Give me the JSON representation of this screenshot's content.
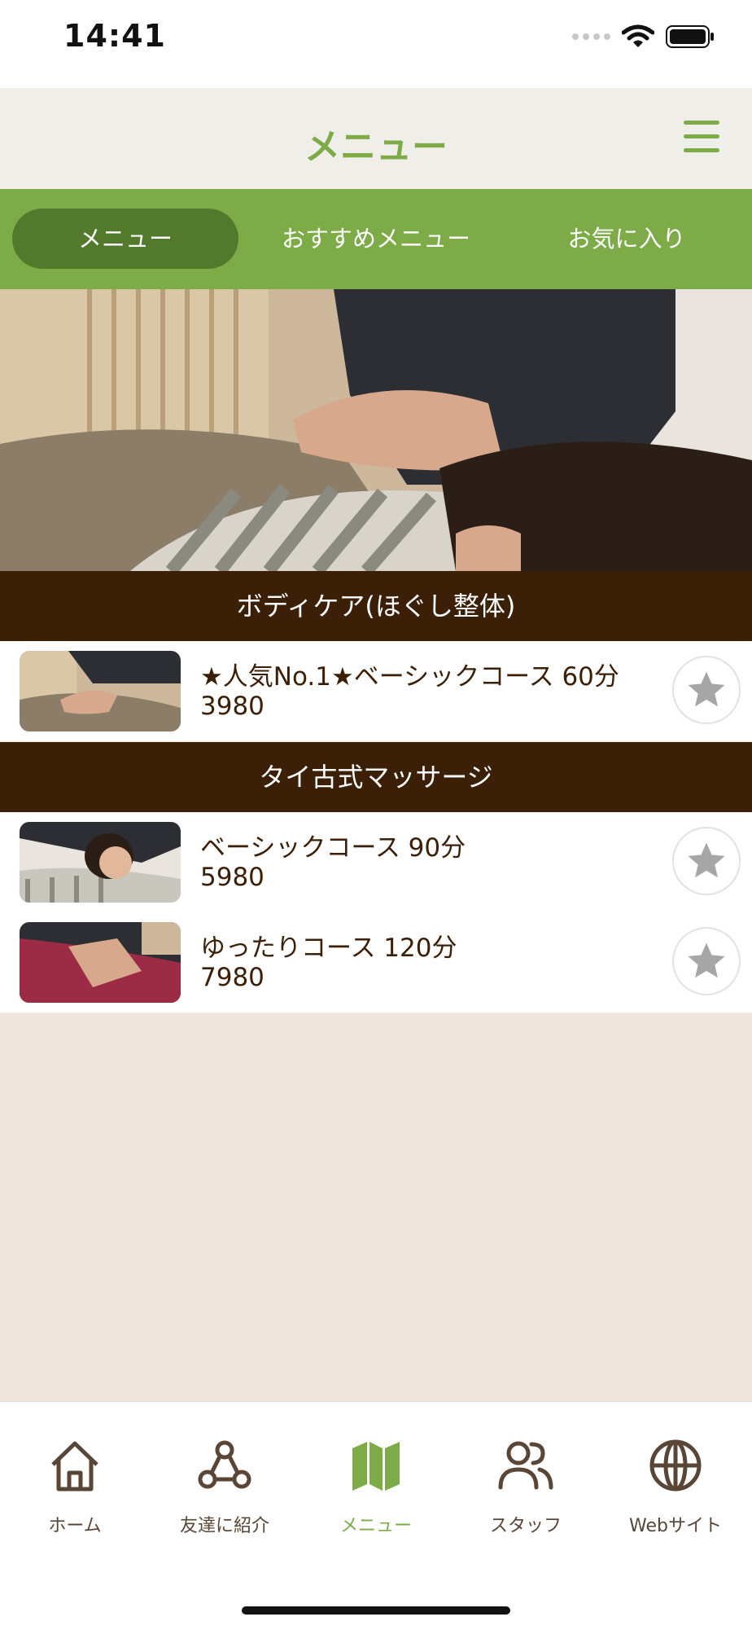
{
  "status_bar": {
    "time": "14:41"
  },
  "header": {
    "title": "メニュー",
    "menu_icon": "hamburger-menu-icon"
  },
  "tabs": [
    {
      "label": "メニュー",
      "active": true
    },
    {
      "label": "おすすめメニュー",
      "active": false
    },
    {
      "label": "お気に入り",
      "active": false
    }
  ],
  "sections": [
    {
      "title": "ボディケア(ほぐし整体)",
      "items": [
        {
          "title": "★人気No.1★ベーシックコース 60分",
          "price": "3980",
          "favorite_icon": "star-icon"
        }
      ]
    },
    {
      "title": "タイ古式マッサージ",
      "items": [
        {
          "title": "ベーシックコース 90分",
          "price": "5980",
          "favorite_icon": "star-icon"
        },
        {
          "title": "ゆったりコース 120分",
          "price": "7980",
          "favorite_icon": "star-icon"
        }
      ]
    }
  ],
  "tab_bar": {
    "items": [
      {
        "label": "ホーム",
        "icon": "home-icon",
        "active": false
      },
      {
        "label": "友達に紹介",
        "icon": "share-icon",
        "active": false
      },
      {
        "label": "メニュー",
        "icon": "map-icon",
        "active": true
      },
      {
        "label": "スタッフ",
        "icon": "people-icon",
        "active": false
      },
      {
        "label": "Webサイト",
        "icon": "globe-icon",
        "active": false
      }
    ]
  },
  "colors": {
    "accent": "#7dab47",
    "accent_dark": "#537a2c",
    "section_bg": "#3b1f07",
    "page_bg": "#efe7df",
    "text_brown": "#3b1f07"
  }
}
